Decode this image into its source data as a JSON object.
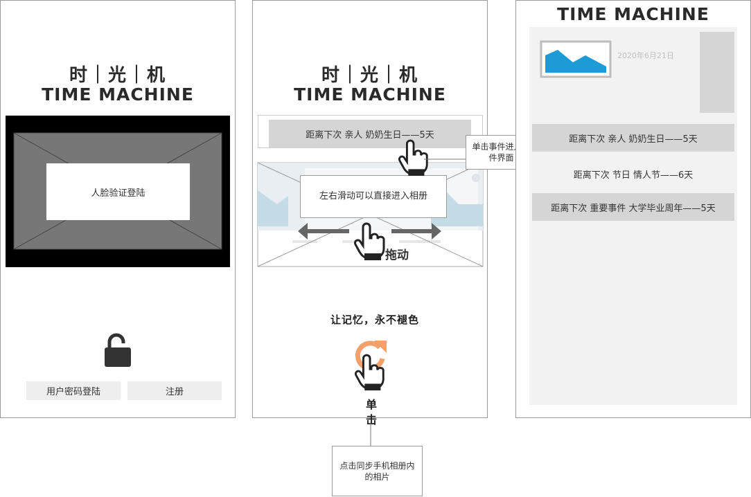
{
  "screen1": {
    "logo_cn": "时｜光｜机",
    "logo_en": "TIME MACHINE",
    "face_login_label": "人脸验证登陆",
    "password_login_button": "用户密码登陆",
    "register_button": "注册",
    "icons": {
      "unlock": "unlock-icon"
    }
  },
  "screen2": {
    "logo_cn": "时｜光｜机",
    "logo_en": "TIME MACHINE",
    "event_bar": "距离下次 亲人 奶奶生日——5天",
    "swipe_hint": "左右滑动可以直接进入相册",
    "drag_label": "拖动",
    "slogan": "让记忆，永不褪色",
    "tap_label": "单击",
    "icons": {
      "hand": "hand-pointer-icon",
      "sync": "sync-icon",
      "arrow_left": "arrow-left-icon",
      "arrow_right": "arrow-right-icon"
    }
  },
  "callouts": {
    "event_callout": "单击事件进入事件界面",
    "sync_callout": "点击同步手机相册内的相片"
  },
  "screen3": {
    "title": "TIME MACHINE",
    "photo_date": "2020年6月21日",
    "events": [
      "距离下次 亲人 奶奶生日——5天",
      "距离下次 节日 情人节——6天",
      "距离下次 重要事件 大学毕业周年——5天"
    ],
    "icons": {
      "photo": "image-icon"
    }
  }
}
